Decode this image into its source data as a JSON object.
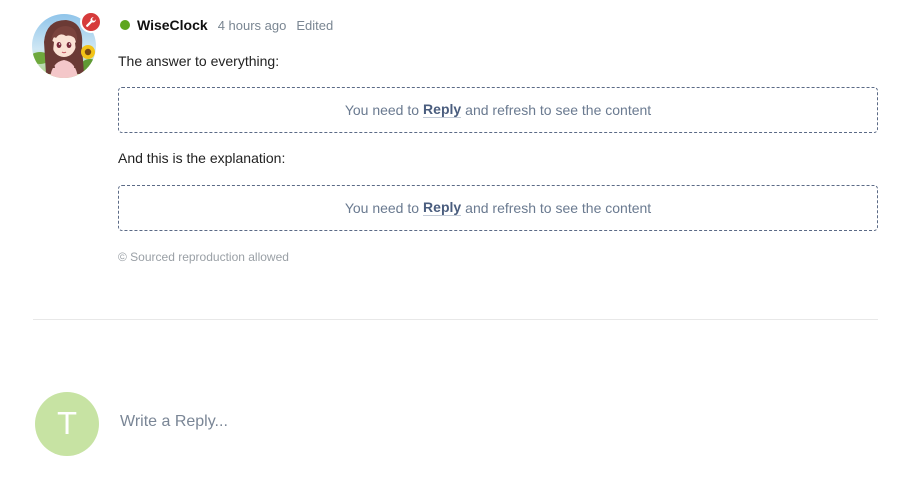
{
  "post": {
    "author": "WiseClock",
    "time": "4 hours ago",
    "edited": "Edited",
    "online": true,
    "paragraphs": [
      "The answer to everything:",
      "And this is the explanation:"
    ],
    "hidden_content": {
      "before": "You need to",
      "link": "Reply",
      "after": "and refresh to see the content"
    },
    "copyright": "© Sourced reproduction allowed"
  },
  "reply_box": {
    "avatar_letter": "T",
    "placeholder": "Write a Reply..."
  },
  "colors": {
    "online": "#5ea51d",
    "mod_badge": "#d63b3b",
    "user_avatar": "#c7e3a3"
  },
  "icons": {
    "mod_badge": "wrench-icon"
  }
}
